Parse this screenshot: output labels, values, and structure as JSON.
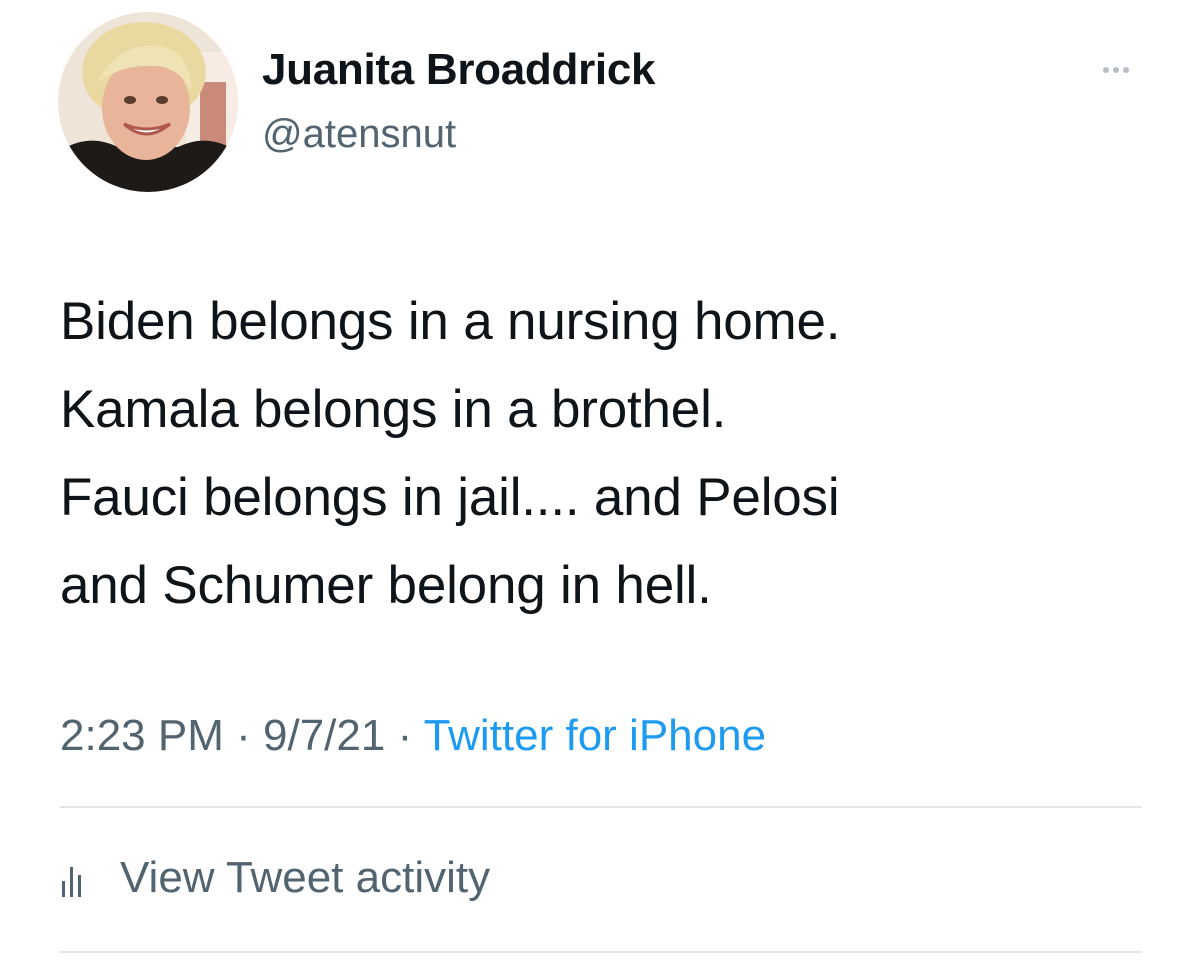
{
  "tweet": {
    "author_name": "Juanita Broaddrick",
    "author_handle": "@atensnut",
    "text_lines": [
      "Biden belongs in a nursing home.",
      "Kamala belongs in a brothel.",
      "Fauci belongs in jail.... and Pelosi",
      "and Schumer belong in hell."
    ],
    "time": "2:23 PM",
    "date": "9/7/21",
    "separator": "·",
    "source": "Twitter for iPhone",
    "activity_label": "View Tweet activity"
  },
  "icons": {
    "more": "more-horizontal-icon",
    "activity": "bar-chart-icon"
  },
  "colors": {
    "text": "#0f1419",
    "secondary": "#536471",
    "link": "#1d9bf0",
    "divider": "#e3e6e8"
  }
}
